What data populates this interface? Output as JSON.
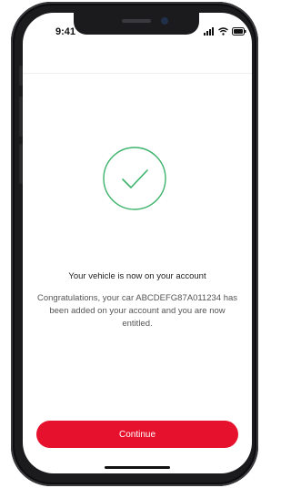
{
  "status_bar": {
    "time": "9:41",
    "icons": [
      "cellular-signal-icon",
      "wifi-icon",
      "battery-icon"
    ]
  },
  "success": {
    "icon": "check-circle-icon",
    "accent_color": "#3bb36a"
  },
  "message": {
    "title": "Your vehicle is now on your account",
    "body": "Congratulations, your car ABCDEFG87A011234 has been added on your account and you are now entitled."
  },
  "actions": {
    "continue_label": "Continue",
    "button_color": "#e6112c"
  }
}
